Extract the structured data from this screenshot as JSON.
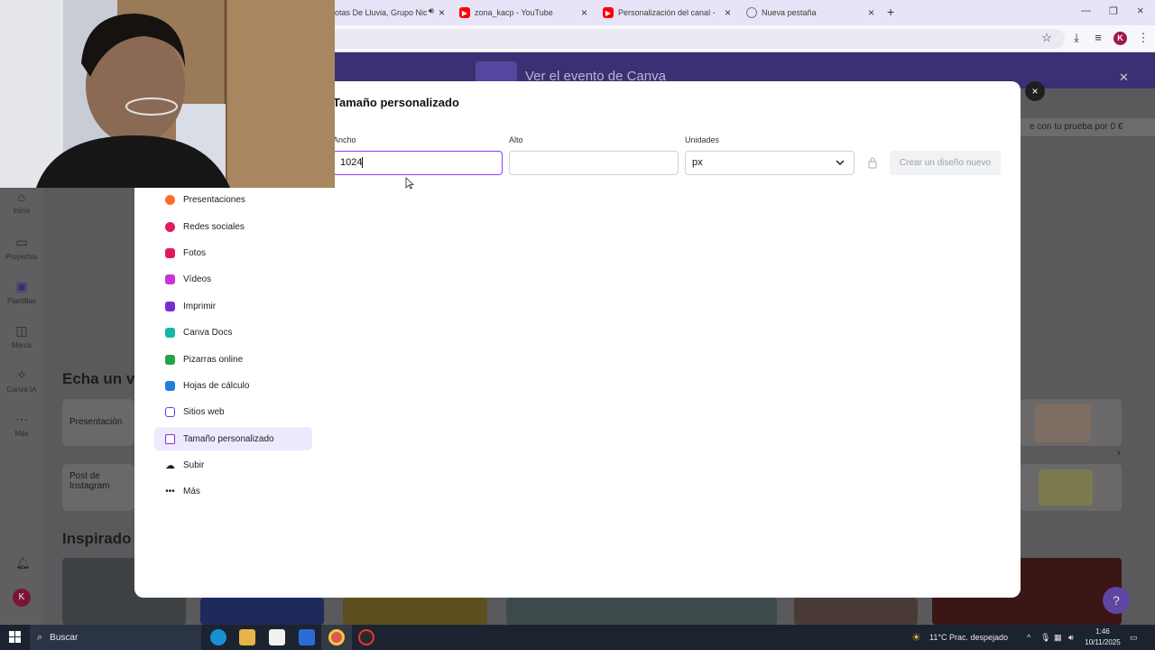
{
  "browser": {
    "tabs": [
      {
        "title": "otas De Lluvia, Grupo Nic",
        "favicon": "speaker-icon"
      },
      {
        "title": "zona_kacp - YouTube",
        "favicon": "youtube-icon"
      },
      {
        "title": "Personalización del canal - You",
        "favicon": "youtube-icon"
      },
      {
        "title": "Nueva pestaña",
        "favicon": "globe-icon"
      }
    ],
    "new_tab_glyph": "+",
    "profile_initial": "K"
  },
  "canva_background": {
    "banner_text": "Ver el evento de Canva",
    "trial_text": "e con tu prueba por 0 €",
    "rail": [
      {
        "label": "Inicio",
        "icon": "home-icon"
      },
      {
        "label": "Proyectos",
        "icon": "folder-icon"
      },
      {
        "label": "Plantillas",
        "icon": "templates-icon"
      },
      {
        "label": "Marca",
        "icon": "brand-icon"
      },
      {
        "label": "Canva IA",
        "icon": "ai-icon"
      },
      {
        "label": "Más",
        "icon": "more-icon"
      }
    ],
    "profile_initial": "K",
    "heading_1": "Echa un vi",
    "heading_2": "Inspirado c",
    "card_1": "Presentación",
    "card_2": "Post de Instagram",
    "help_glyph": "?"
  },
  "modal": {
    "title": "Tamaño personalizado",
    "width_label": "Ancho",
    "width_value": "1024",
    "height_label": "Alto",
    "height_value": "",
    "units_label": "Unidades",
    "units_value": "px",
    "create_button": "Crear un diseño nuevo",
    "close_glyph": "×"
  },
  "menu": [
    {
      "label": "Presentaciones",
      "icon": "presentation-icon",
      "color": "#ff6b2c"
    },
    {
      "label": "Redes sociales",
      "icon": "social-icon",
      "color": "#e3195a"
    },
    {
      "label": "Fotos",
      "icon": "camera-icon",
      "color": "#e3195a"
    },
    {
      "label": "Vídeos",
      "icon": "video-icon",
      "color": "#c933d9"
    },
    {
      "label": "Imprimir",
      "icon": "print-icon",
      "color": "#7b2cd1"
    },
    {
      "label": "Canva Docs",
      "icon": "docs-icon",
      "color": "#14b8a6"
    },
    {
      "label": "Pizarras online",
      "icon": "whiteboard-icon",
      "color": "#22a447"
    },
    {
      "label": "Hojas de cálculo",
      "icon": "spreadsheet-icon",
      "color": "#1d7fe0"
    },
    {
      "label": "Sitios web",
      "icon": "website-icon",
      "color": "#4f46e5"
    },
    {
      "label": "Tamaño personalizado",
      "icon": "custom-size-icon",
      "color": "#7d2ae8"
    },
    {
      "label": "Subir",
      "icon": "cloud-upload-icon",
      "color": "#1b1e22"
    },
    {
      "label": "Más",
      "icon": "more-icon",
      "color": "#1b1e22"
    }
  ],
  "taskbar": {
    "search_placeholder": "Buscar",
    "weather": "11°C  Prac. despejado",
    "time": "1:46",
    "date": "10/11/2025"
  }
}
